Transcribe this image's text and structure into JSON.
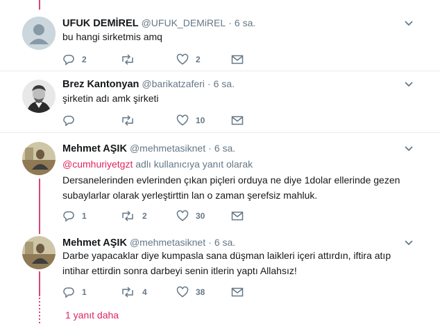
{
  "tweets": [
    {
      "name": "UFUK DEMİREL",
      "handle": "@UFUK_DEMiREL",
      "time": "6 sa.",
      "text": "bu hangi sirketmis amq",
      "reply_to": null,
      "counts": {
        "replies": "2",
        "retweets": "",
        "likes": "2"
      },
      "avatar_icon": "default-egg-avatar"
    },
    {
      "name": "Brez Kantonyan",
      "handle": "@barikatzaferi",
      "time": "6 sa.",
      "text": "şirketin adı amk şirketi",
      "reply_to": null,
      "counts": {
        "replies": "",
        "retweets": "",
        "likes": "10"
      },
      "avatar_icon": "portrait-avatar"
    },
    {
      "name": "Mehmet AŞIK",
      "handle": "@mehmetasiknet",
      "time": "6 sa.",
      "text": "Dersanelerinden evlerinden çıkan piçleri orduya ne diye 1dolar ellerinde gezen subaylarlar olarak yerleştirttin lan o zaman şerefsiz mahluk.",
      "reply_to": {
        "mention": "@cumhuriyetgzt",
        "suffix": " adlı kullanıcıya yanıt olarak"
      },
      "counts": {
        "replies": "1",
        "retweets": "2",
        "likes": "30"
      },
      "avatar_icon": "photo-avatar"
    },
    {
      "name": "Mehmet AŞIK",
      "handle": "@mehmetasiknet",
      "time": "6 sa.",
      "text": "Darbe yapacaklar diye kumpasla sana düşman laikleri içeri attırdın, iftira atıp intihar ettirdin sonra darbeyi senin itlerin yaptı Allahsız!",
      "reply_to": null,
      "counts": {
        "replies": "1",
        "retweets": "4",
        "likes": "38"
      },
      "avatar_icon": "photo-avatar"
    }
  ],
  "show_more": "1 yanıt daha",
  "colors": {
    "accent": "#e0245e",
    "thread": "#d6467a",
    "muted": "#657786",
    "divider": "#e6ecf0"
  }
}
